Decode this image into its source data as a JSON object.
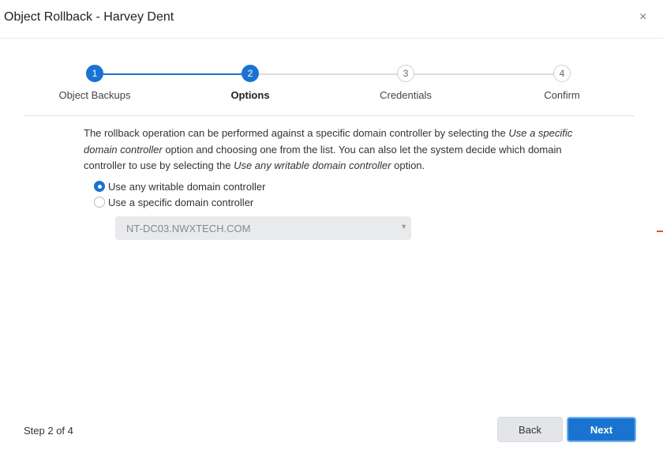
{
  "dialog": {
    "title": "Object Rollback - Harvey Dent",
    "close_label": "×"
  },
  "stepper": {
    "steps": [
      {
        "number": "1",
        "label": "Object Backups",
        "state": "done"
      },
      {
        "number": "2",
        "label": "Options",
        "state": "current"
      },
      {
        "number": "3",
        "label": "Credentials",
        "state": "todo"
      },
      {
        "number": "4",
        "label": "Confirm",
        "state": "todo"
      }
    ]
  },
  "options": {
    "description": {
      "p1": "The rollback operation can be performed against a specific domain controller by selecting the ",
      "em1": "Use a specific domain controller",
      "p2": " option and choosing one from the list. You can also let the system decide which domain controller to use by selecting the ",
      "em2": "Use any writable domain controller",
      "p3": " option."
    },
    "radio_any": {
      "label": "Use any writable domain controller",
      "checked": true
    },
    "radio_specific": {
      "label": "Use a specific domain controller",
      "checked": false
    },
    "dc_select": {
      "value": "NT-DC03.NWXTECH.COM",
      "disabled": true
    }
  },
  "footer": {
    "step_count": "Step 2 of 4",
    "back_label": "Back",
    "next_label": "Next"
  },
  "colors": {
    "accent": "#1a73d0",
    "inactive_line": "#dcdcdc",
    "select_bg": "#e9eaec"
  },
  "icons": {
    "close": "close-icon",
    "caret": "caret-down-icon",
    "radio_checked": "radio-checked-icon",
    "radio_unchecked": "radio-unchecked-icon"
  }
}
